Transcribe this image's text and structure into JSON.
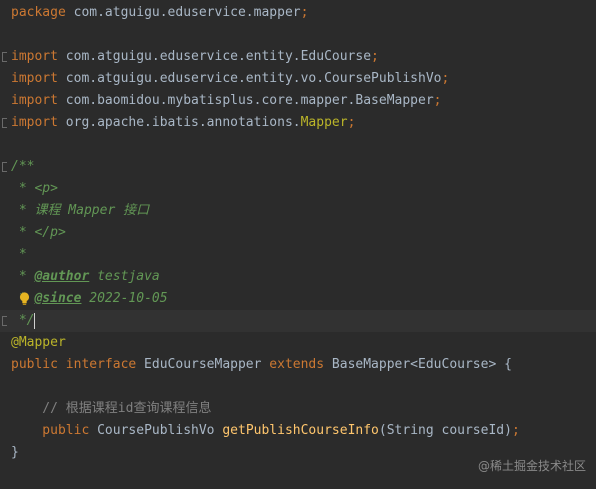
{
  "lines": {
    "l1": [
      "package",
      " com.atguigu.eduservice.mapper",
      ";"
    ],
    "l3": [
      "import",
      " com.atguigu.eduservice.entity.EduCourse",
      ";"
    ],
    "l4": [
      "import",
      " com.atguigu.eduservice.entity.vo.CoursePublishVo",
      ";"
    ],
    "l5": [
      "import",
      " com.baomidou.mybatisplus.core.mapper.BaseMapper",
      ";"
    ],
    "l6": [
      "import",
      " org.apache.ibatis.annotations.",
      "Mapper",
      ";"
    ],
    "l8": "/**",
    "l9": " * <p>",
    "l10": " * 课程 Mapper 接口",
    "l11": " * </p>",
    "l12": " *",
    "l13": [
      " * ",
      "@author",
      " testjava"
    ],
    "l14": [
      " * ",
      "@since",
      " 2022-10-05"
    ],
    "l15": " */",
    "l16": "@Mapper",
    "l17": [
      "public interface",
      " EduCourseMapper ",
      "extends",
      " BaseMapper<EduCourse> {"
    ],
    "l19": "    // 根据课程id查询课程信息",
    "l20": [
      "    public",
      " CoursePublishVo ",
      "getPublishCourseInfo",
      "(String courseId)",
      ";"
    ],
    "l21": "}"
  },
  "watermark": "@稀土掘金技术社区",
  "icons": {
    "intention": "lightbulb-icon",
    "fold": "fold-marker-icon"
  },
  "colors": {
    "background": "#2b2b2b",
    "current_line": "#323232",
    "keyword": "#cc7832",
    "text": "#a9b7c6",
    "annotation": "#bbb529",
    "doc_comment": "#629755",
    "line_comment": "#808080",
    "method": "#ffc66d",
    "bulb": "#e6b422"
  }
}
